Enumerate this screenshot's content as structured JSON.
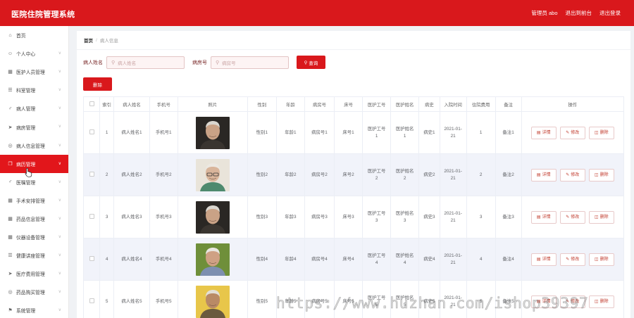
{
  "header": {
    "app_title": "医院住院管理系统",
    "admin_label": "管理员 abo",
    "front_label": "退出到前台",
    "logout_label": "退出登录"
  },
  "sidebar": {
    "items": [
      {
        "label": "首页",
        "icon": "home-icon"
      },
      {
        "label": "个人中心",
        "icon": "user-icon"
      },
      {
        "label": "医护人员管理",
        "icon": "grid-icon"
      },
      {
        "label": "科室管理",
        "icon": "list-icon"
      },
      {
        "label": "病人管理",
        "icon": "person-icon"
      },
      {
        "label": "病房管理",
        "icon": "send-icon"
      },
      {
        "label": "病人信息管理",
        "icon": "compass-icon"
      },
      {
        "label": "病历管理",
        "icon": "copy-icon"
      },
      {
        "label": "医嘱管理",
        "icon": "person-icon"
      },
      {
        "label": "手术安排管理",
        "icon": "grid-icon"
      },
      {
        "label": "药品信息管理",
        "icon": "grid-icon"
      },
      {
        "label": "仪器设备管理",
        "icon": "grid-icon"
      },
      {
        "label": "健康讲座管理",
        "icon": "list-icon"
      },
      {
        "label": "医疗费用管理",
        "icon": "send-icon"
      },
      {
        "label": "药品购买管理",
        "icon": "compass-icon"
      },
      {
        "label": "系统管理",
        "icon": "flag-icon"
      }
    ],
    "active_index": 7
  },
  "breadcrumb": {
    "home": "首页",
    "separator": "/",
    "current": "病人信息"
  },
  "search": {
    "name_label": "病人姓名",
    "name_placeholder": "病人姓名",
    "room_label": "病房号",
    "room_placeholder": "病房号",
    "search_button": "查询",
    "delete_button": "删除"
  },
  "table": {
    "columns": [
      "索引",
      "病人姓名",
      "手机号",
      "照片",
      "性别",
      "年龄",
      "病房号",
      "床号",
      "医护工号",
      "医护姓名",
      "病史",
      "入院时间",
      "住院费用",
      "备注",
      "操作"
    ],
    "rows": [
      {
        "index": "1",
        "name": "病人姓名1",
        "phone": "手机号1",
        "gender": "性别1",
        "age": "年龄1",
        "room": "病房号1",
        "bed": "床号1",
        "staff_no_a": "医护工号",
        "staff_no_b": "1",
        "staff_name_a": "医护姓名",
        "staff_name_b": "1",
        "history": "病史1",
        "date_a": "2021-01-",
        "date_b": "21",
        "fee": "1",
        "note": "备注1",
        "photo": "elderly-man-dark"
      },
      {
        "index": "2",
        "name": "病人姓名2",
        "phone": "手机号2",
        "gender": "性别2",
        "age": "年龄2",
        "room": "病房号2",
        "bed": "床号2",
        "staff_no_a": "医护工号",
        "staff_no_b": "2",
        "staff_name_a": "医护姓名",
        "staff_name_b": "2",
        "history": "病史2",
        "date_a": "2021-01-",
        "date_b": "21",
        "fee": "2",
        "note": "备注2",
        "photo": "elderly-woman-glasses"
      },
      {
        "index": "3",
        "name": "病人姓名3",
        "phone": "手机号3",
        "gender": "性别3",
        "age": "年龄3",
        "room": "病房号3",
        "bed": "床号3",
        "staff_no_a": "医护工号",
        "staff_no_b": "3",
        "staff_name_a": "医护姓名",
        "staff_name_b": "3",
        "history": "病史3",
        "date_a": "2021-01-",
        "date_b": "21",
        "fee": "3",
        "note": "备注3",
        "photo": "elderly-man-dark"
      },
      {
        "index": "4",
        "name": "病人姓名4",
        "phone": "手机号4",
        "gender": "性别4",
        "age": "年龄4",
        "room": "病房号4",
        "bed": "床号4",
        "staff_no_a": "医护工号",
        "staff_no_b": "4",
        "staff_name_a": "医护姓名",
        "staff_name_b": "4",
        "history": "病史4",
        "date_a": "2021-01-",
        "date_b": "21",
        "fee": "4",
        "note": "备注4",
        "photo": "elderly-man-garden"
      },
      {
        "index": "5",
        "name": "病人姓名5",
        "phone": "手机号5",
        "gender": "性别5",
        "age": "年龄5",
        "room": "病房号5",
        "bed": "床号5",
        "staff_no_a": "医护工号",
        "staff_no_b": "5",
        "staff_name_a": "医护姓名",
        "staff_name_b": "5",
        "history": "病史5",
        "date_a": "2021-01-",
        "date_b": "21",
        "fee": "5",
        "note": "备注5",
        "photo": "elderly-man-yellow"
      }
    ],
    "ops": {
      "detail": "详情",
      "edit": "修改",
      "delete": "删除"
    }
  },
  "watermark": "https://www.huzhan.com/ishop39397",
  "colors": {
    "brand": "#d9181c",
    "stripe": "#f1f3fa"
  }
}
